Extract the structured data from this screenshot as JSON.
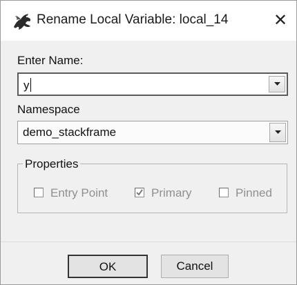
{
  "dialog": {
    "title": "Rename Local Variable: local_14",
    "close_glyph": "✕",
    "app_icon": "dragon-icon"
  },
  "name_field": {
    "label": "Enter Name:",
    "value": "y"
  },
  "namespace_field": {
    "label": "Namespace",
    "value": "demo_stackframe"
  },
  "properties": {
    "title": "Properties",
    "entry_point": {
      "label": "Entry Point",
      "checked": false,
      "enabled": false
    },
    "primary": {
      "label": "Primary",
      "checked": true,
      "enabled": false
    },
    "pinned": {
      "label": "Pinned",
      "checked": false,
      "enabled": false
    }
  },
  "buttons": {
    "ok_label": "OK",
    "cancel_label": "Cancel"
  },
  "colors": {
    "disabled_text": "#8f8f8f",
    "dialog_bg": "#f0f0f0",
    "titlebar_bg": "#ffffff"
  }
}
